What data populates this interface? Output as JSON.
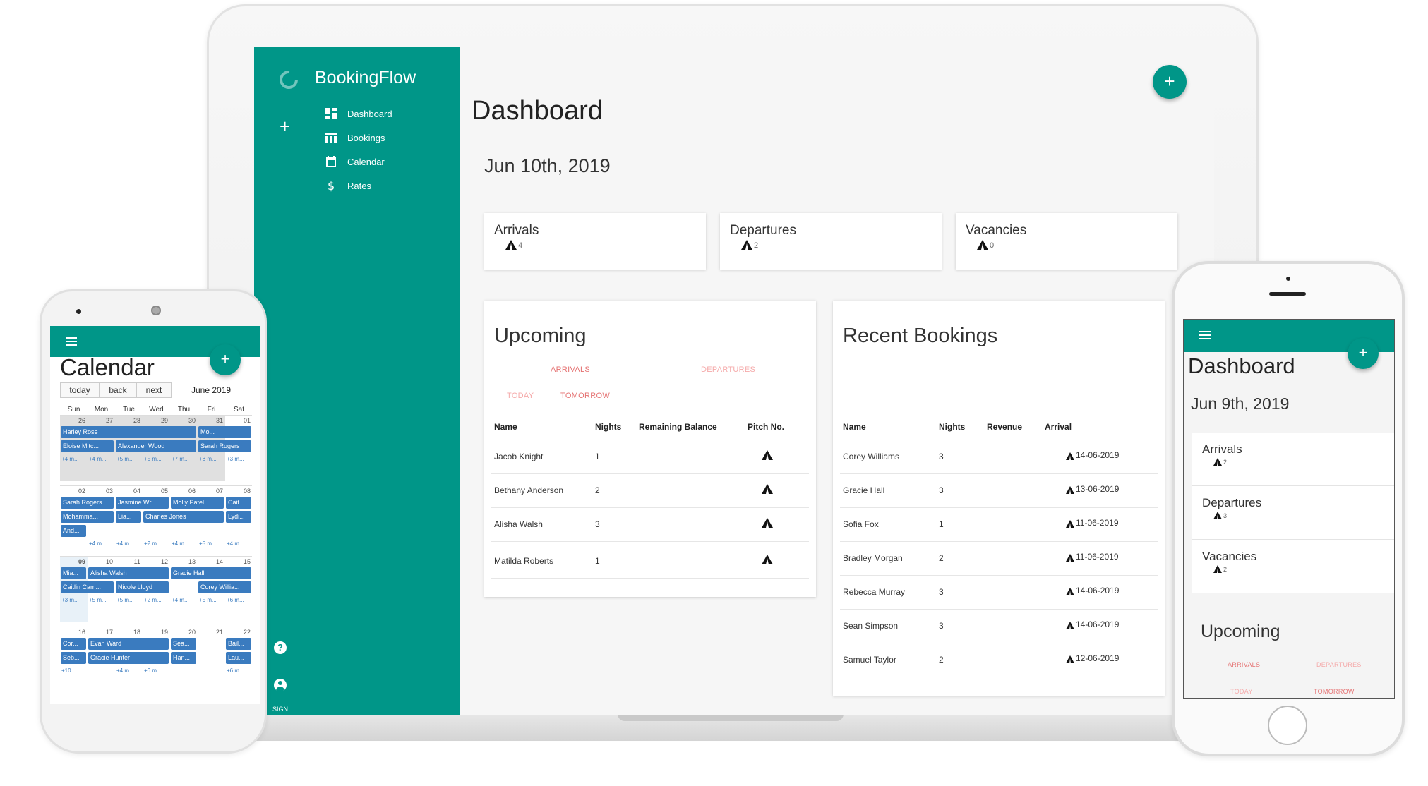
{
  "laptop": {
    "brand": "BookingFlow",
    "nav": [
      {
        "label": "Dashboard",
        "icon": "dashboard-icon"
      },
      {
        "label": "Bookings",
        "icon": "table-icon"
      },
      {
        "label": "Calendar",
        "icon": "calendar-icon"
      },
      {
        "label": "Rates",
        "icon": "dollar-icon"
      }
    ],
    "sign_text": "SIGN",
    "page_title": "Dashboard",
    "date": "Jun 10th, 2019",
    "fab_label": "+",
    "stats": [
      {
        "label": "Arrivals",
        "value": "4"
      },
      {
        "label": "Departures",
        "value": "2"
      },
      {
        "label": "Vacancies",
        "value": "0"
      }
    ],
    "upcoming": {
      "title": "Upcoming",
      "tab_arrivals": "ARRIVALS",
      "tab_departures": "DEPARTURES",
      "tab_today": "TODAY",
      "tab_tomorrow": "TOMORROW",
      "columns": [
        "Name",
        "Nights",
        "Remaining Balance",
        "Pitch No."
      ],
      "rows": [
        {
          "name": "Jacob Knight",
          "nights": "1"
        },
        {
          "name": "Bethany Anderson",
          "nights": "2"
        },
        {
          "name": "Alisha Walsh",
          "nights": "3"
        },
        {
          "name": "Matilda Roberts",
          "nights": "1"
        }
      ]
    },
    "recent": {
      "title": "Recent Bookings",
      "columns": [
        "Name",
        "Nights",
        "Revenue",
        "Arrival"
      ],
      "rows": [
        {
          "name": "Corey Williams",
          "nights": "3",
          "arrival": "14-06-2019"
        },
        {
          "name": "Gracie Hall",
          "nights": "3",
          "arrival": "13-06-2019"
        },
        {
          "name": "Sofia Fox",
          "nights": "1",
          "arrival": "11-06-2019"
        },
        {
          "name": "Bradley Morgan",
          "nights": "2",
          "arrival": "11-06-2019"
        },
        {
          "name": "Rebecca Murray",
          "nights": "3",
          "arrival": "14-06-2019"
        },
        {
          "name": "Sean Simpson",
          "nights": "3",
          "arrival": "14-06-2019"
        },
        {
          "name": "Samuel Taylor",
          "nights": "2",
          "arrival": "12-06-2019"
        }
      ]
    }
  },
  "android": {
    "title": "Calendar",
    "fab_label": "+",
    "btn_today": "today",
    "btn_back": "back",
    "btn_next": "next",
    "month": "June 2019",
    "days": [
      "Sun",
      "Mon",
      "Tue",
      "Wed",
      "Thu",
      "Fri",
      "Sat"
    ],
    "weeks": [
      {
        "nums": [
          "26",
          "27",
          "28",
          "29",
          "30",
          "31",
          "01"
        ],
        "events": [
          {
            "label": "Harley Rose"
          },
          {
            "label": "Mo..."
          },
          {
            "label": "Eloise Mitc..."
          },
          {
            "label": "Alexander Wood"
          },
          {
            "label": "Sarah Rogers"
          }
        ],
        "more": [
          "+4 m...",
          "+4 m...",
          "+5 m...",
          "+5 m...",
          "+7 m...",
          "+8 m...",
          "+3 m..."
        ]
      },
      {
        "nums": [
          "02",
          "03",
          "04",
          "05",
          "06",
          "07",
          "08"
        ],
        "events": [
          {
            "label": "Sarah Rogers"
          },
          {
            "label": "Jasmine Wr..."
          },
          {
            "label": "Molly Patel"
          },
          {
            "label": "Cait..."
          },
          {
            "label": "Mohamma..."
          },
          {
            "label": "Lia..."
          },
          {
            "label": "Charles Jones"
          },
          {
            "label": "Lydi..."
          },
          {
            "label": "And..."
          }
        ],
        "more": [
          "+4 m...",
          "+4 m...",
          "+2 m...",
          "+4 m...",
          "+5 m...",
          "+4 m..."
        ]
      },
      {
        "nums": [
          "09",
          "10",
          "11",
          "12",
          "13",
          "14",
          "15"
        ],
        "events": [
          {
            "label": "Mia..."
          },
          {
            "label": "Alisha Walsh"
          },
          {
            "label": "Gracie Hall"
          },
          {
            "label": "Caitlin Cam..."
          },
          {
            "label": "Nicole Lloyd"
          },
          {
            "label": "Corey Willia..."
          }
        ],
        "more": [
          "+3 m...",
          "+5 m...",
          "+5 m...",
          "+2 m...",
          "+4 m...",
          "+5 m...",
          "+6 m..."
        ]
      },
      {
        "nums": [
          "16",
          "17",
          "18",
          "19",
          "20",
          "21",
          "22"
        ],
        "events": [
          {
            "label": "Cor..."
          },
          {
            "label": "Evan Ward"
          },
          {
            "label": "Sea..."
          },
          {
            "label": "Bail..."
          },
          {
            "label": "Seb..."
          },
          {
            "label": "Gracie Hunter"
          },
          {
            "label": "Han..."
          },
          {
            "label": "Lau..."
          }
        ],
        "more": [
          "+10 ...",
          "+4 m...",
          "+6 m...",
          "+6 m..."
        ]
      }
    ]
  },
  "iphone": {
    "title": "Dashboard",
    "date": "Jun 9th, 2019",
    "fab_label": "+",
    "stats": [
      {
        "label": "Arrivals",
        "value": "2"
      },
      {
        "label": "Departures",
        "value": "3"
      },
      {
        "label": "Vacancies",
        "value": "2"
      }
    ],
    "upcoming_title": "Upcoming",
    "tab_arrivals": "ARRIVALS",
    "tab_departures": "DEPARTURES",
    "tab_today": "TODAY",
    "tab_tomorrow": "TOMORROW"
  },
  "colors": {
    "primary": "#009688",
    "accent_tab": "#e57373",
    "event": "#3a7bbf"
  }
}
